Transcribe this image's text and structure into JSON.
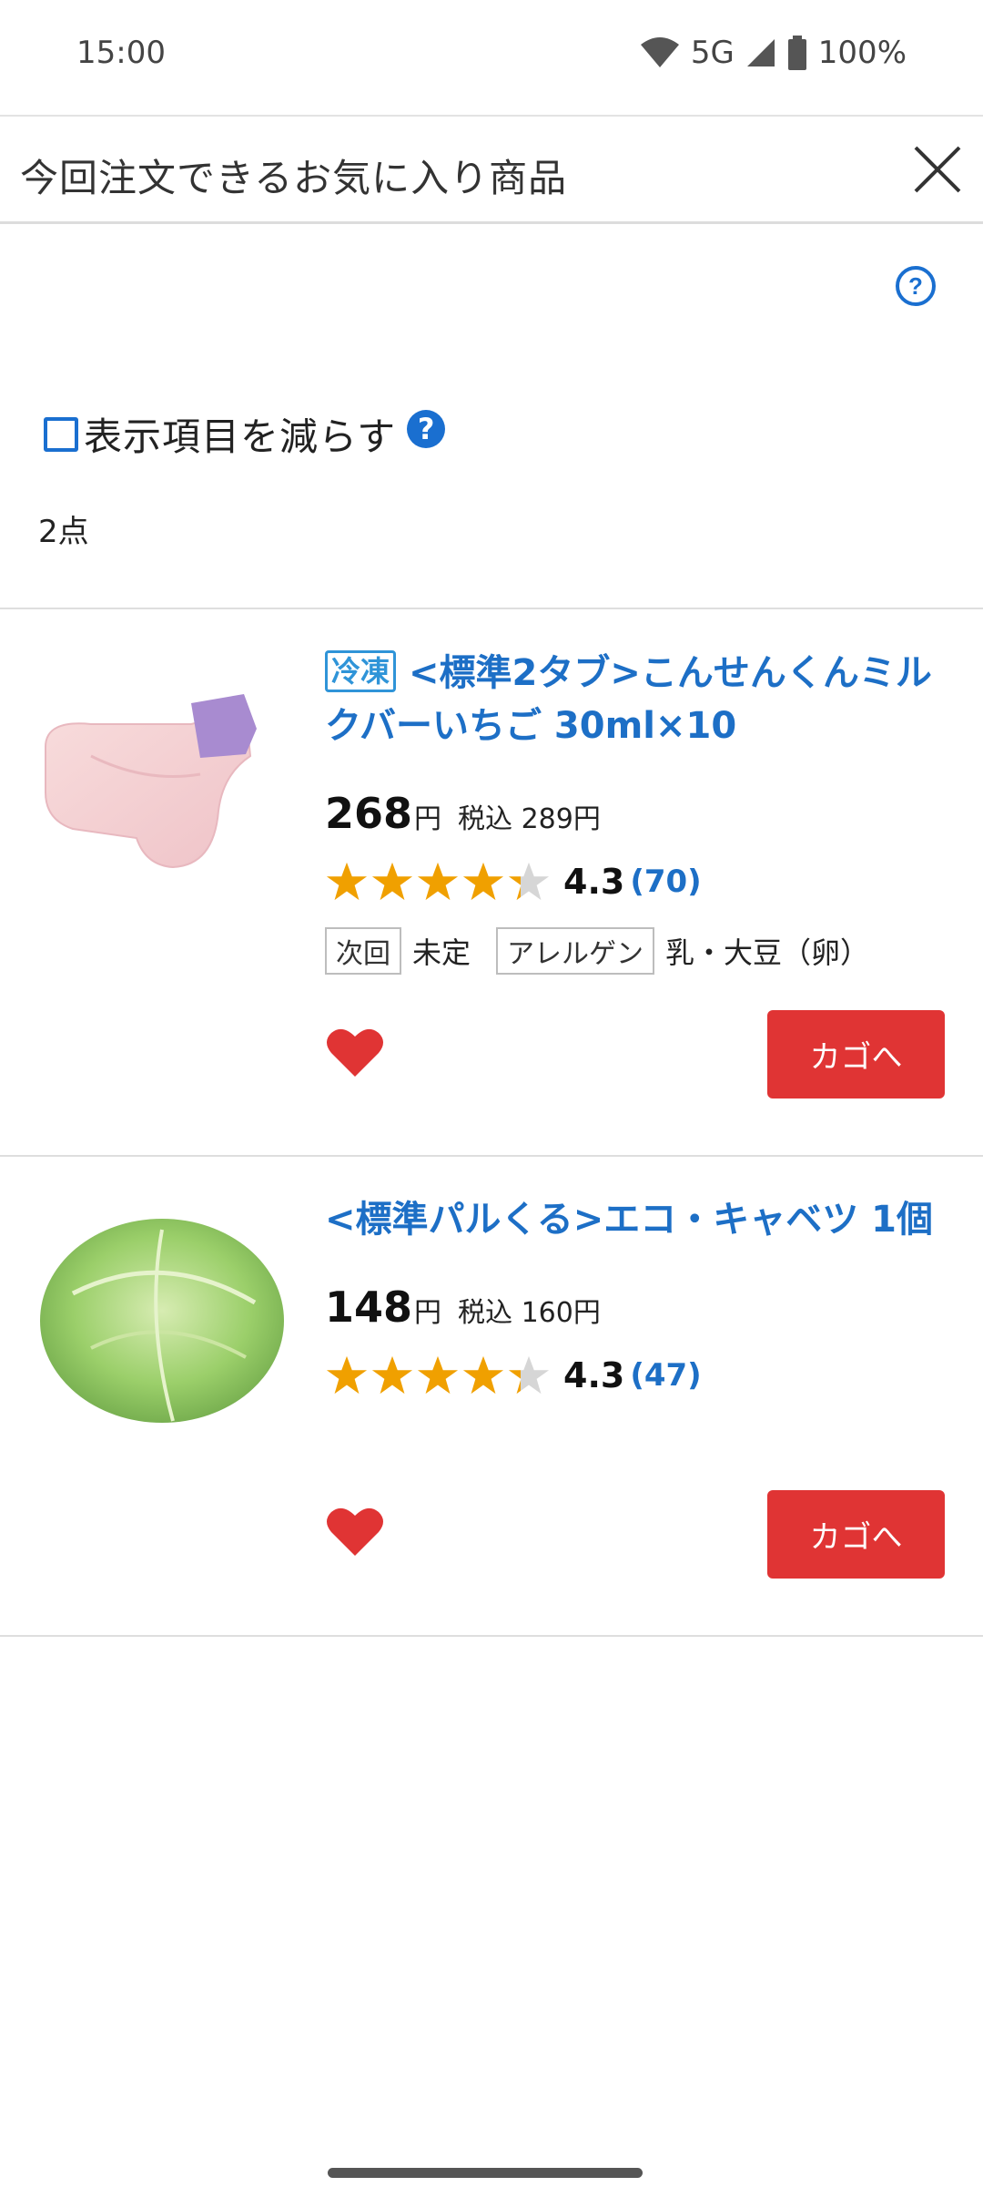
{
  "status_bar": {
    "time": "15:00",
    "network": "5G",
    "battery": "100%"
  },
  "header": {
    "title": "今回注文できるお気に入り商品"
  },
  "controls": {
    "reduce_label": "表示項目を減らす",
    "help_glyph": "?"
  },
  "list": {
    "count": "2点"
  },
  "products": [
    {
      "tag": "冷凍",
      "title": "<標準2タブ>こんせんくんミルクバーいちご 30ml×10",
      "price": "268",
      "yen": "円",
      "tax_included": "税込 289円",
      "rating": 4.3,
      "rating_text": "4.3",
      "review_count": "(70)",
      "next_label": "次回",
      "next_value": "未定",
      "allergen_label": "アレルゲン",
      "allergen_value": "乳・大豆（卵）",
      "cart_label": "カゴへ",
      "favorite": true
    },
    {
      "title": "<標準パルくる>エコ・キャベツ 1個",
      "price": "148",
      "yen": "円",
      "tax_included": "税込 160円",
      "rating": 4.3,
      "rating_text": "4.3",
      "review_count": "(47)",
      "cart_label": "カゴへ",
      "favorite": true
    }
  ],
  "colors": {
    "link_blue": "#1d6fc6",
    "cart_red": "#e03434",
    "star_orange": "#f0a000",
    "heart_red": "#e03434"
  }
}
